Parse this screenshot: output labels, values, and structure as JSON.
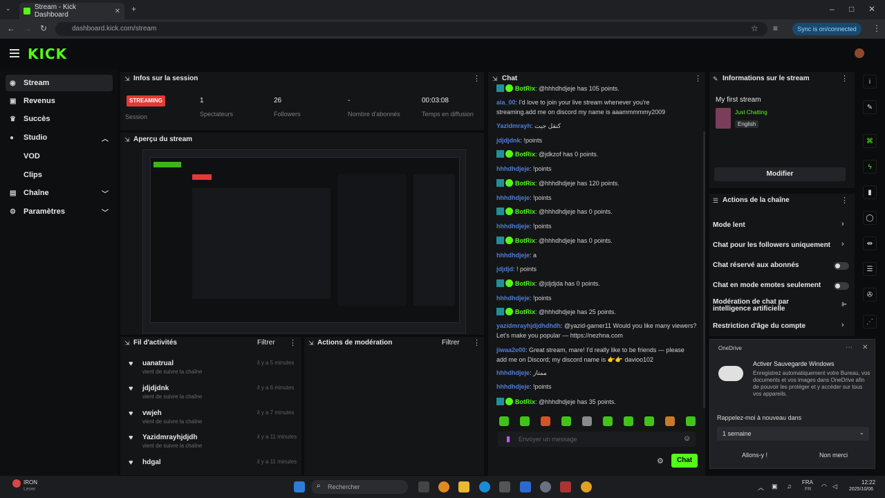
{
  "browser": {
    "tab_title": "Stream - Kick Dashboard",
    "url": "dashboard.kick.com/stream",
    "resume_label": "Sync is on/connected"
  },
  "brand": {
    "logo": "KICK",
    "accent": "#53fc18"
  },
  "sidebar": {
    "items": [
      {
        "label": "Stream",
        "icon": "broadcast-icon"
      },
      {
        "label": "Revenus",
        "icon": "money-icon"
      },
      {
        "label": "Succès",
        "icon": "trophy-icon"
      },
      {
        "label": "Studio",
        "icon": "camera-icon"
      },
      {
        "label": "VOD"
      },
      {
        "label": "Clips"
      },
      {
        "label": "Chaîne",
        "icon": "channel-icon"
      },
      {
        "label": "Paramètres",
        "icon": "gear-icon"
      }
    ]
  },
  "session": {
    "title": "Infos sur la session",
    "status": "STREAMING",
    "status_label": "Session",
    "stats": [
      {
        "value": "1",
        "label": "Spectateurs"
      },
      {
        "value": "26",
        "label": "Followers"
      },
      {
        "value": "-",
        "label": "Nombre d'abonnés"
      },
      {
        "value": "00:03:08",
        "label": "Temps en diffusion"
      }
    ]
  },
  "preview": {
    "title": "Aperçu du stream"
  },
  "activity": {
    "title": "Fil d'activités",
    "filter": "Filtrer",
    "items": [
      {
        "name": "uanatrual",
        "sub": "vient de suivre la chaîne",
        "time": "il y a 5 minutes"
      },
      {
        "name": "jdjdjdnk",
        "sub": "vient de suivre la chaîne",
        "time": "il y a 6 minutes"
      },
      {
        "name": "vwjeh",
        "sub": "vient de suivre la chaîne",
        "time": "il y a 7 minutes"
      },
      {
        "name": "Yazidmrayhjdjdh",
        "sub": "vient de suivre la chaîne",
        "time": "il y a 11 minutes"
      },
      {
        "name": "hdgal",
        "sub": "",
        "time": "il y a 11 minutes"
      }
    ]
  },
  "moderation": {
    "title": "Actions de modération",
    "filter": "Filtrer"
  },
  "chat": {
    "title": "Chat",
    "lines": [
      {
        "user": "BotRix",
        "bot": true,
        "text": "@hhhdhdjeje has 105 points."
      },
      {
        "user": "aia_00",
        "bot": false,
        "text": ": I'd love to join your live stream whenever you're"
      },
      {
        "user": "",
        "bot": false,
        "text": "streaming.add me on discord my name is aaammmmmy2009"
      },
      {
        "user": "Yazidmrayh",
        "bot": false,
        "text": ": كنقل جيت"
      },
      {
        "user": "jdjdjdnk",
        "bot": false,
        "text": ": !points"
      },
      {
        "user": "BotRix",
        "bot": true,
        "text": "@jdkzof has 0 points."
      },
      {
        "user": "hhhdhdjeje",
        "bot": false,
        "text": ": !points"
      },
      {
        "user": "BotRix",
        "bot": true,
        "text": "@hhhdhdjeje has 120 points."
      },
      {
        "user": "hhhdhdjeje",
        "bot": false,
        "text": ": !points"
      },
      {
        "user": "BotRix",
        "bot": true,
        "text": "@hhhdhdjeje has 0 points."
      },
      {
        "user": "hhhdhdjeje",
        "bot": false,
        "text": ": !points"
      },
      {
        "user": "BotRix",
        "bot": true,
        "text": "@hhhdhdjeje has 0 points."
      },
      {
        "user": "hhhdhdjeje",
        "bot": false,
        "text": ": a"
      },
      {
        "user": "jdjdjd",
        "bot": false,
        "text": ": ! points"
      },
      {
        "user": "BotRix",
        "bot": true,
        "text": "@jdjdjda has 0 points."
      },
      {
        "user": "hhhdhdjeje",
        "bot": false,
        "text": ": !points"
      },
      {
        "user": "BotRix",
        "bot": true,
        "text": "@hhhdhdjeje has 25 points."
      },
      {
        "user": "yazidmrayhjdjdhdhdh",
        "bot": false,
        "text": ": @yazid-gamer11 Would you like many viewers?"
      },
      {
        "user": "",
        "bot": false,
        "text": "Let's make you popular — https://nezhna.com"
      },
      {
        "user": "jiwaa2e00",
        "bot": false,
        "text": ": Great stream, mare! I'd really like to be friends — please"
      },
      {
        "user": "",
        "bot": false,
        "text": "add me on Discord; my discord name is 👉👉 davioo102"
      },
      {
        "user": "hhhdhdjeje",
        "bot": false,
        "text": ": ممتاز"
      },
      {
        "user": "hhhdhdjeje",
        "bot": false,
        "text": ": !points"
      },
      {
        "user": "BotRix",
        "bot": true,
        "text": "@hhhdhdjeje has 35 points."
      }
    ],
    "input_placeholder": "Envoyer un message",
    "send_label": "Chat"
  },
  "stream_info": {
    "title": "Informations sur le stream",
    "stream_title": "My first stream",
    "category": "Just Chatting",
    "language": "English",
    "modify_label": "Modifier"
  },
  "channel_actions": {
    "title": "Actions de la chaîne",
    "items": [
      {
        "label": "Mode lent",
        "control": "chevron"
      },
      {
        "label": "Chat pour les followers uniquement",
        "control": "chevron"
      },
      {
        "label": "Chat réservé aux abonnés",
        "control": "toggle"
      },
      {
        "label": "Chat en mode emotes seulement",
        "control": "toggle"
      },
      {
        "label": "Modération de chat par intelligence artificielle",
        "control": "icon"
      },
      {
        "label": "Restriction d'âge du compte",
        "control": "chevron"
      }
    ]
  },
  "toast": {
    "app": "OneDrive",
    "heading": "Activer Sauvegarde Windows",
    "body": "Enregistrez automatiquement votre Bureau, vos documents et vos images dans OneDrive afin de pouvoir les protéger et y accéder sur tous vos appareils.",
    "remind_label": "Rappelez-moi à nouveau dans",
    "remind_value": "1 semaine",
    "go_label": "Allons-y !",
    "no_label": "Non merci"
  },
  "taskbar": {
    "search_placeholder": "Rechercher",
    "lang": "FRA",
    "lang_sub": "FR",
    "time": "12:22",
    "date": "2025/10/06",
    "weather": "IRON",
    "weather_sub": "Lever"
  }
}
